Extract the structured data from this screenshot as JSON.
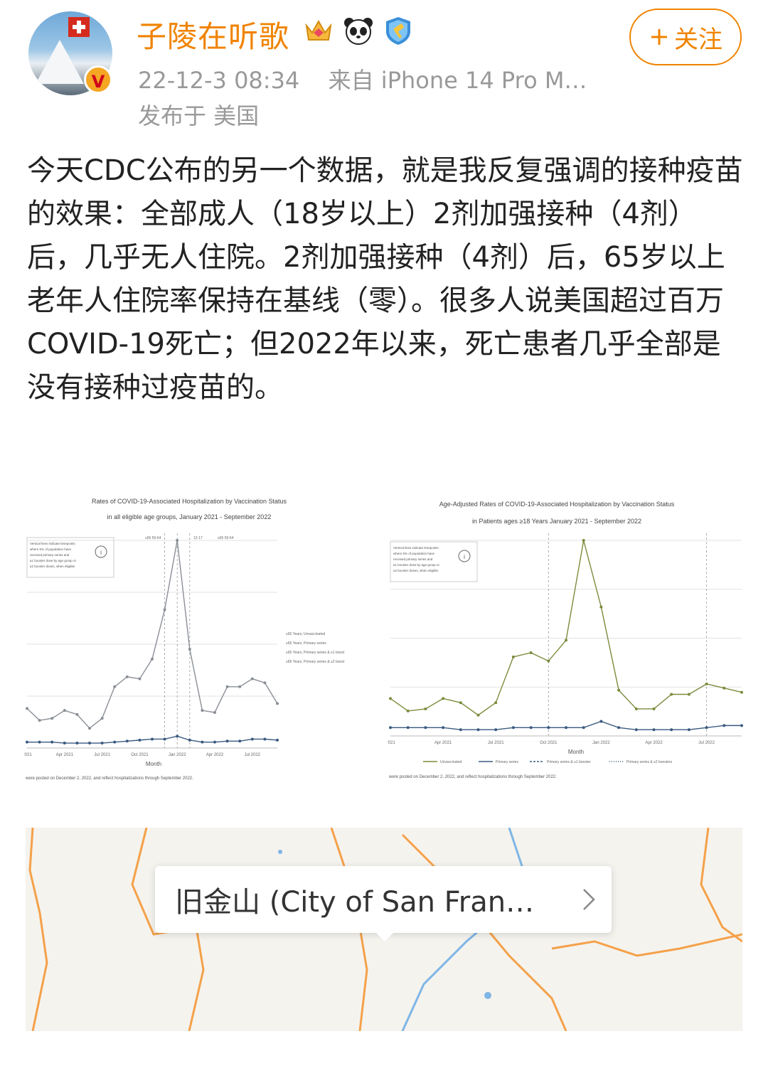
{
  "user": {
    "name": "子陵在听歌",
    "timestamp": "22-12-3 08:34",
    "source": "来自 iPhone 14 Pro M…",
    "location": "发布于 美国",
    "verified_mark": "V"
  },
  "follow_button": {
    "label": "关注"
  },
  "post": {
    "text": "今天CDC公布的另一个数据，就是我反复强调的接种疫苗的效果：全部成人（18岁以上）2剂加强接种（4剂）后，几乎无人住院。2剂加强接种（4剂）后，65岁以上老年人住院率保持在基线（零）。很多人说美国超过百万COVID-19死亡；但2022年以来，死亡患者几乎全部是没有接种过疫苗的。"
  },
  "images": {
    "left": {
      "title1": "Rates of COVID-19-Associated Hospitalization by Vaccination Status",
      "title2": "in all eligible age groups, January 2021 - September 2022",
      "note": [
        "Vertical lines indicate timepoints",
        "where 5% of population have",
        "received primary series and",
        "≥1 booster dose by age group or",
        "≥2 booster doses, when eligible."
      ],
      "legend": [
        "≥65 Years, Unvaccinated",
        "≥65 Years, Primary series",
        "≥65 Years, Primary series & ≥1 boost",
        "≥65 Years, Primary series & ≥2 boost"
      ],
      "top_labels": [
        "≥65 50-64",
        "12-17",
        "≥65 50-64"
      ],
      "x_ticks": [
        "2021",
        "Apr 2021",
        "Jul 2021",
        "Oct 2021",
        "Jan 2022",
        "Apr 2022",
        "Jul 2022"
      ],
      "xlabel": "Month",
      "footer": "were posted on December 2, 2022, and reflect hospitalizations through September 2022."
    },
    "right": {
      "title1": "Age-Adjusted Rates of COVID-19-Associated Hospitalization by Vaccination Status",
      "title2": "in Patients ages ≥18 Years January 2021 - September 2022",
      "note": [
        "Vertical lines indicate timepoints",
        "where 5% of population have",
        "received primary series and",
        "≥1 booster dose by age group or",
        "≥2 booster doses, when eligible."
      ],
      "legend": [
        "Unvaccinated",
        "Primary series",
        "Primary series & ≥1 booster",
        "Primary series & ≥2 boosters"
      ],
      "x_ticks": [
        "2021",
        "Apr 2021",
        "Jul 2021",
        "Oct 2021",
        "Jan 2022",
        "Apr 2022",
        "Jul 2022"
      ],
      "xlabel": "Month",
      "footer": "were posted on December 2, 2022, and reflect hospitalizations through September 2022."
    }
  },
  "location_card": {
    "label": "旧金山 (City of San Fran…"
  },
  "colors": {
    "orange": "#f08300",
    "meta_gray": "#999999",
    "unvaccinated": "#7a8c3c",
    "primary": "#3a5a80"
  },
  "chart_data": [
    {
      "type": "line",
      "x": [
        "2021-01",
        "2021-02",
        "2021-03",
        "2021-04",
        "2021-05",
        "2021-06",
        "2021-07",
        "2021-08",
        "2021-09",
        "2021-10",
        "2021-11",
        "2021-12",
        "2022-01",
        "2022-02",
        "2022-03",
        "2022-04",
        "2022-05",
        "2022-06",
        "2022-07",
        "2022-08",
        "2022-09"
      ],
      "series": [
        {
          "name": "≥65 Years, Unvaccinated",
          "values": [
            40,
            28,
            30,
            38,
            34,
            20,
            30,
            62,
            72,
            70,
            90,
            140,
            210,
            100,
            38,
            36,
            62,
            62,
            70,
            66,
            45
          ]
        },
        {
          "name": "≥65 Years, Primary series",
          "values": [
            6,
            6,
            6,
            5,
            5,
            5,
            5,
            6,
            7,
            8,
            9,
            9,
            12,
            8,
            6,
            6,
            7,
            7,
            9,
            9,
            8
          ]
        }
      ]
    },
    {
      "type": "line",
      "x": [
        "2021-01",
        "2021-02",
        "2021-03",
        "2021-04",
        "2021-05",
        "2021-06",
        "2021-07",
        "2021-08",
        "2021-09",
        "2021-10",
        "2021-11",
        "2021-12",
        "2022-01",
        "2022-02",
        "2022-03",
        "2022-04",
        "2022-05",
        "2022-06",
        "2022-07",
        "2022-08",
        "2022-09"
      ],
      "series": [
        {
          "name": "Unvaccinated",
          "values": [
            18,
            12,
            13,
            18,
            16,
            10,
            16,
            38,
            40,
            36,
            46,
            94,
            62,
            22,
            13,
            13,
            20,
            20,
            25,
            23,
            21
          ]
        },
        {
          "name": "Primary series",
          "values": [
            4,
            4,
            4,
            4,
            3,
            3,
            3,
            4,
            4,
            4,
            4,
            4,
            7,
            4,
            3,
            3,
            3,
            3,
            4,
            5,
            5
          ]
        }
      ]
    }
  ]
}
